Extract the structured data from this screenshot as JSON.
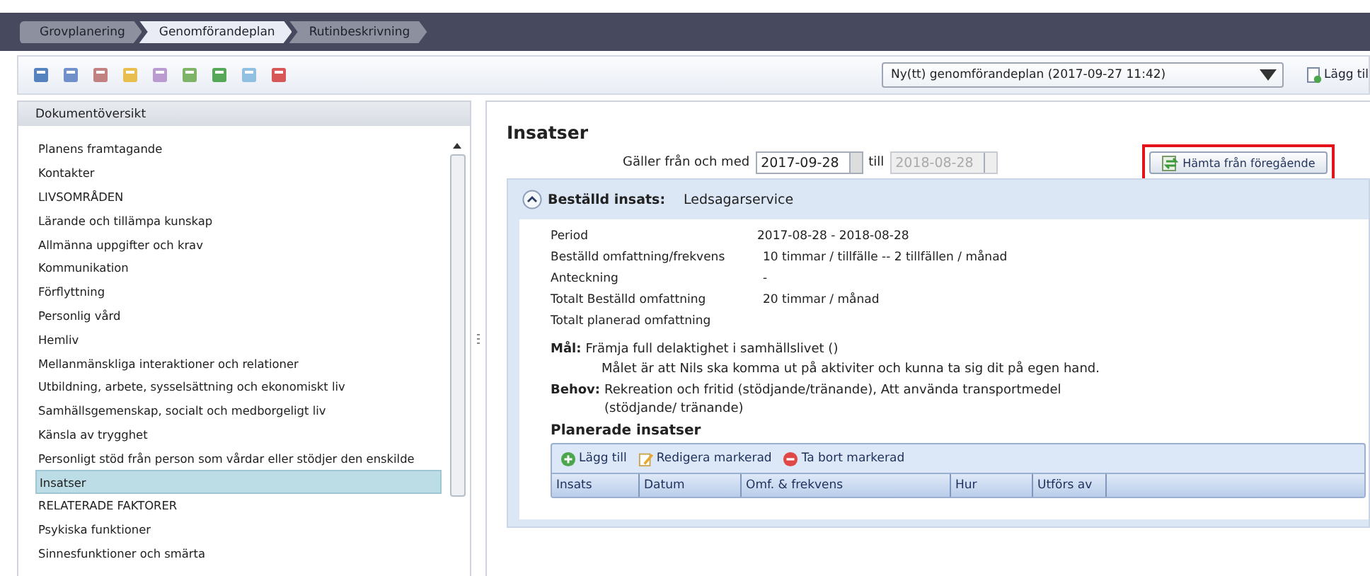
{
  "breadcrumbs": [
    {
      "label": "Grovplanering",
      "selected": false
    },
    {
      "label": "Genomförandeplan",
      "selected": true
    },
    {
      "label": "Rutinbeskrivning",
      "selected": false
    }
  ],
  "plan_select": {
    "value": "Ny(tt) genomförandeplan (2017-09-27 11:42)"
  },
  "add_button": {
    "label": "Lägg til"
  },
  "sidebar": {
    "title": "Dokumentöversikt",
    "items": [
      {
        "label": "Planens framtagande",
        "selected": false
      },
      {
        "label": "Kontakter",
        "selected": false
      },
      {
        "label": "LIVSOMRÅDEN",
        "selected": false
      },
      {
        "label": "Lärande och tillämpa kunskap",
        "selected": false
      },
      {
        "label": "Allmänna uppgifter och krav",
        "selected": false
      },
      {
        "label": "Kommunikation",
        "selected": false
      },
      {
        "label": "Förflyttning",
        "selected": false
      },
      {
        "label": "Personlig vård",
        "selected": false
      },
      {
        "label": "Hemliv",
        "selected": false
      },
      {
        "label": "Mellanmänskliga interaktioner och relationer",
        "selected": false
      },
      {
        "label": "Utbildning, arbete, sysselsättning och ekonomiskt liv",
        "selected": false
      },
      {
        "label": "Samhällsgemenskap, socialt och medborgeligt liv",
        "selected": false
      },
      {
        "label": "Känsla av trygghet",
        "selected": false
      },
      {
        "label": "Personligt stöd från person som vårdar eller stödjer den enskilde",
        "selected": false
      },
      {
        "label": "Insatser",
        "selected": true
      },
      {
        "label": "RELATERADE FAKTORER",
        "selected": false
      },
      {
        "label": "Psykiska funktioner",
        "selected": false
      },
      {
        "label": "Sinnesfunktioner och smärta",
        "selected": false
      }
    ]
  },
  "content": {
    "title": "Insatser",
    "validity": {
      "from_label": "Gäller från och med",
      "from": "2017-09-28",
      "to_label": "till",
      "to": "2018-08-28",
      "to_disabled": true
    },
    "fetch_button": {
      "label": "Hämta från föregående",
      "highlighted": true
    },
    "ordered": {
      "label": "Beställd insats:",
      "value": "Ledsagarservice",
      "expanded": true,
      "details": [
        {
          "label": "Period",
          "value": "2017-08-28 - 2018-08-28"
        },
        {
          "label": "Beställd omfattning/frekvens",
          "value": "10 timmar / tillfälle -- 2 tillfällen / månad"
        },
        {
          "label": "Anteckning",
          "value": "-"
        },
        {
          "label": "Totalt Beställd omfattning",
          "value": "20 timmar / månad"
        },
        {
          "label": "Totalt planerad omfattning"
        }
      ],
      "goal": {
        "label": "Mål:",
        "text": "Främja full delaktighet i samhällslivet ()",
        "description": "Målet är att Nils ska komma ut på aktiviter och kunna ta sig dit på egen hand."
      },
      "need": {
        "label": "Behov:",
        "text": "Rekreation och fritid (stödjande/tränande), Att använda transportmedel (stödjande/ tränande)"
      },
      "planned": {
        "title": "Planerade insatser",
        "actions": [
          {
            "label": "Lägg till",
            "kind": "add"
          },
          {
            "label": "Redigera markerad",
            "kind": "edit"
          },
          {
            "label": "Ta bort markerad",
            "kind": "delete"
          }
        ],
        "columns": [
          "Insats",
          "Datum",
          "Omf. & frekvens",
          "Hur",
          "Utförs av"
        ]
      }
    }
  }
}
